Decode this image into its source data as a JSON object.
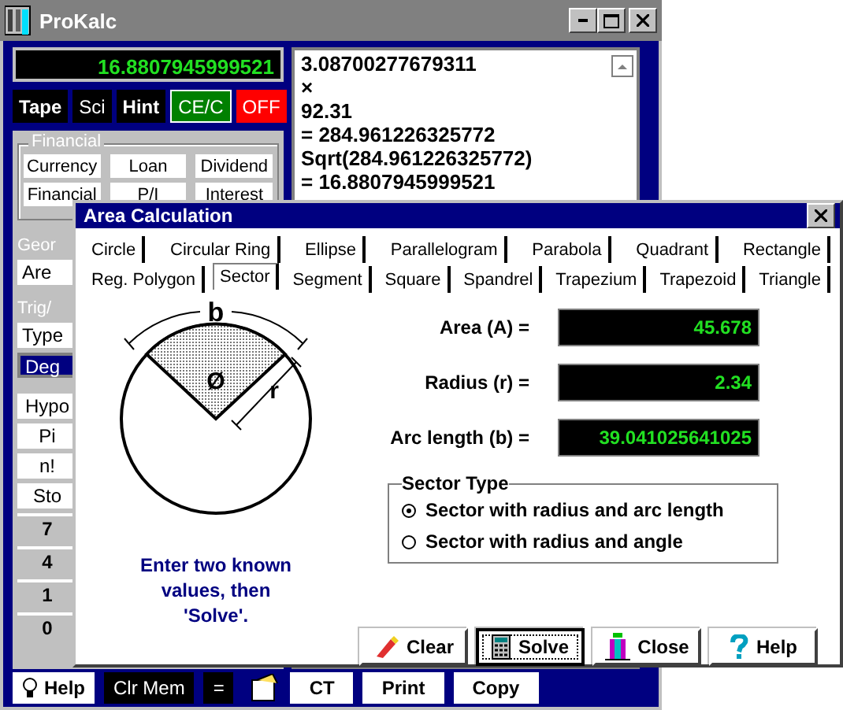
{
  "main_window": {
    "title": "ProKalc",
    "display": "16.8807945999521",
    "mode_buttons": [
      {
        "label": "Tape",
        "kind": "toggle",
        "on": true
      },
      {
        "label": "Sci",
        "kind": "toggle",
        "on": false
      },
      {
        "label": "Hint",
        "kind": "toggle",
        "on": true
      },
      {
        "label": "CE/C",
        "kind": "clear"
      },
      {
        "label": "OFF",
        "kind": "power"
      }
    ],
    "financial": {
      "title": "Financial",
      "buttons": [
        "Currency",
        "Loan",
        "Dividend",
        "Financial",
        "P/I",
        "Interest"
      ]
    },
    "geometry": {
      "title": "Geor",
      "buttons": [
        "Are"
      ]
    },
    "trig": {
      "title": "Trig/",
      "buttons": [
        {
          "label": "Type",
          "selected": false
        },
        {
          "label": "Deg",
          "selected": true
        }
      ]
    },
    "keys": [
      {
        "label": "Hypo",
        "kind": "function"
      },
      {
        "label": "Pi",
        "kind": "function"
      },
      {
        "label": "n!",
        "kind": "function"
      },
      {
        "label": "Sto",
        "kind": "function"
      },
      {
        "label": "7",
        "kind": "digit"
      },
      {
        "label": "4",
        "kind": "digit"
      },
      {
        "label": "1",
        "kind": "digit"
      },
      {
        "label": "0",
        "kind": "digit"
      }
    ],
    "tape": [
      "3.08700277679311",
      "×",
      "92.31",
      "= 284.961226325772",
      "Sqrt(284.961226325772)",
      "= 16.8807945999521"
    ],
    "bottom_buttons": [
      {
        "label": "Help",
        "kind": "help"
      },
      {
        "label": "Clr Mem",
        "kind": "dark"
      },
      {
        "label": "=",
        "kind": "dark"
      },
      {
        "label": "CT",
        "kind": "light"
      },
      {
        "label": "Print",
        "kind": "light"
      },
      {
        "label": "Copy",
        "kind": "light"
      }
    ]
  },
  "dialog": {
    "title": "Area Calculation",
    "tab_rows": [
      [
        {
          "label": "Circle",
          "selected": false
        },
        {
          "label": "Circular Ring",
          "selected": false
        },
        {
          "label": "Ellipse",
          "selected": false
        },
        {
          "label": "Parallelogram",
          "selected": false
        },
        {
          "label": "Parabola",
          "selected": false
        },
        {
          "label": "Quadrant",
          "selected": false
        },
        {
          "label": "Rectangle",
          "selected": false
        }
      ],
      [
        {
          "label": "Reg. Polygon",
          "selected": false
        },
        {
          "label": "Sector",
          "selected": true
        },
        {
          "label": "Segment",
          "selected": false
        },
        {
          "label": "Square",
          "selected": false
        },
        {
          "label": "Spandrel",
          "selected": false
        },
        {
          "label": "Trapezium",
          "selected": false
        },
        {
          "label": "Trapezoid",
          "selected": false
        },
        {
          "label": "Triangle",
          "selected": false
        }
      ]
    ],
    "diagram_labels": {
      "arc": "b",
      "angle": "Ø",
      "radius": "r"
    },
    "hint": "Enter two known values, then 'Solve'.",
    "fields": [
      {
        "label": "Area (A) =",
        "value": "45.678"
      },
      {
        "label": "Radius (r) =",
        "value": "2.34"
      },
      {
        "label": "Arc length (b) =",
        "value": "39.041025641025"
      }
    ],
    "sector_type": {
      "title": "Sector Type",
      "options": [
        {
          "label": "Sector with radius and arc length",
          "selected": true
        },
        {
          "label": "Sector with radius and angle",
          "selected": false
        }
      ]
    },
    "buttons": [
      {
        "label": "Clear",
        "kind": "clear"
      },
      {
        "label": "Solve",
        "kind": "solve"
      },
      {
        "label": "Close",
        "kind": "close"
      },
      {
        "label": "Help",
        "kind": "help"
      }
    ]
  }
}
